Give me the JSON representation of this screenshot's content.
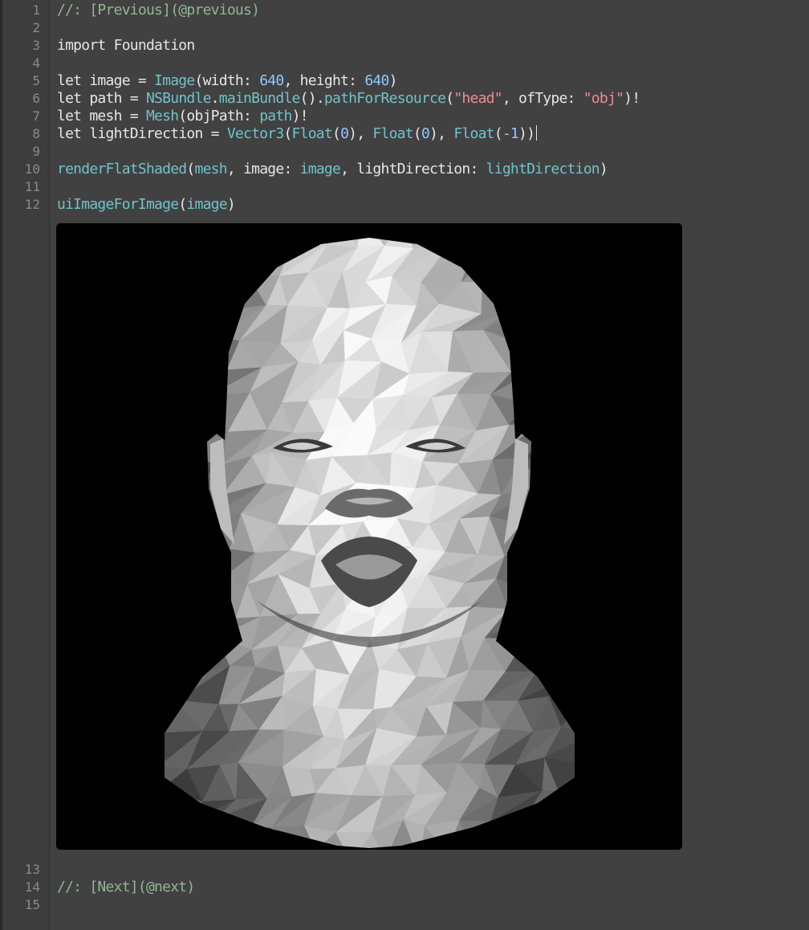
{
  "editor": {
    "lines": [
      {
        "n": "1",
        "tokens": [
          {
            "t": "//: [Previous](@previous)",
            "k": "comment"
          }
        ]
      },
      {
        "n": "2",
        "tokens": []
      },
      {
        "n": "3",
        "tokens": [
          {
            "t": "import Foundation",
            "k": "plain"
          }
        ]
      },
      {
        "n": "4",
        "tokens": []
      },
      {
        "n": "5",
        "tokens": [
          {
            "t": "let image = ",
            "k": "plain"
          },
          {
            "t": "Image",
            "k": "type"
          },
          {
            "t": "(width: ",
            "k": "plain"
          },
          {
            "t": "640",
            "k": "num"
          },
          {
            "t": ", height: ",
            "k": "plain"
          },
          {
            "t": "640",
            "k": "num"
          },
          {
            "t": ")",
            "k": "plain"
          }
        ]
      },
      {
        "n": "6",
        "tokens": [
          {
            "t": "let path = ",
            "k": "plain"
          },
          {
            "t": "NSBundle",
            "k": "type"
          },
          {
            "t": ".",
            "k": "plain"
          },
          {
            "t": "mainBundle",
            "k": "fn"
          },
          {
            "t": "().",
            "k": "plain"
          },
          {
            "t": "pathForResource",
            "k": "fn"
          },
          {
            "t": "(",
            "k": "plain"
          },
          {
            "t": "\"head\"",
            "k": "str"
          },
          {
            "t": ", ofType: ",
            "k": "plain"
          },
          {
            "t": "\"obj\"",
            "k": "str"
          },
          {
            "t": ")!",
            "k": "plain"
          }
        ]
      },
      {
        "n": "7",
        "tokens": [
          {
            "t": "let mesh = ",
            "k": "plain"
          },
          {
            "t": "Mesh",
            "k": "type"
          },
          {
            "t": "(objPath: ",
            "k": "plain"
          },
          {
            "t": "path",
            "k": "fn"
          },
          {
            "t": ")!",
            "k": "plain"
          }
        ]
      },
      {
        "n": "8",
        "tokens": [
          {
            "t": "let lightDirection = ",
            "k": "plain"
          },
          {
            "t": "Vector3",
            "k": "type"
          },
          {
            "t": "(",
            "k": "plain"
          },
          {
            "t": "Float",
            "k": "type"
          },
          {
            "t": "(",
            "k": "plain"
          },
          {
            "t": "0",
            "k": "num"
          },
          {
            "t": "), ",
            "k": "plain"
          },
          {
            "t": "Float",
            "k": "type"
          },
          {
            "t": "(",
            "k": "plain"
          },
          {
            "t": "0",
            "k": "num"
          },
          {
            "t": "), ",
            "k": "plain"
          },
          {
            "t": "Float",
            "k": "type"
          },
          {
            "t": "(",
            "k": "plain"
          },
          {
            "t": "-1",
            "k": "num"
          },
          {
            "t": "))",
            "k": "plain"
          }
        ],
        "caret": true
      },
      {
        "n": "9",
        "tokens": []
      },
      {
        "n": "10",
        "tokens": [
          {
            "t": "renderFlatShaded",
            "k": "fn"
          },
          {
            "t": "(",
            "k": "plain"
          },
          {
            "t": "mesh",
            "k": "fn"
          },
          {
            "t": ", image: ",
            "k": "plain"
          },
          {
            "t": "image",
            "k": "fn"
          },
          {
            "t": ", lightDirection: ",
            "k": "plain"
          },
          {
            "t": "lightDirection",
            "k": "fn"
          },
          {
            "t": ")",
            "k": "plain"
          }
        ]
      },
      {
        "n": "11",
        "tokens": []
      },
      {
        "n": "12",
        "tokens": [
          {
            "t": "uiImageForImage",
            "k": "fn"
          },
          {
            "t": "(",
            "k": "plain"
          },
          {
            "t": "image",
            "k": "fn"
          },
          {
            "t": ")",
            "k": "plain"
          }
        ]
      },
      {
        "n": "13",
        "tokens": []
      },
      {
        "n": "14",
        "tokens": [
          {
            "t": "//: [Next](@next)",
            "k": "comment"
          }
        ]
      },
      {
        "n": "15",
        "tokens": []
      }
    ]
  },
  "preview": {
    "background": "#000000",
    "subject": "flat-shaded head mesh"
  },
  "colors": {
    "editor_bg": "#414141",
    "gutter_bg": "#3d3d3d",
    "comment": "#8fb791",
    "type": "#6fc3ca",
    "number": "#8ec7ff",
    "string": "#f08c8c",
    "plain": "#e6e6e6"
  }
}
